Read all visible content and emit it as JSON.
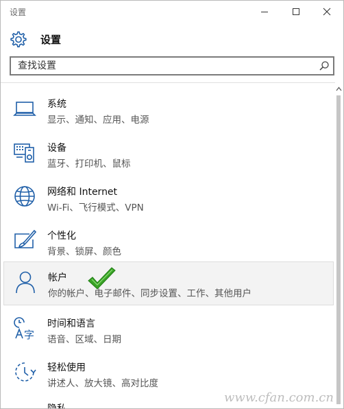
{
  "window": {
    "title": "设置"
  },
  "header": {
    "title": "设置"
  },
  "search": {
    "placeholder": "查找设置"
  },
  "categories": [
    {
      "name": "系统",
      "desc": "显示、通知、应用、电源",
      "icon": "laptop-icon"
    },
    {
      "name": "设备",
      "desc": "蓝牙、打印机、鼠标",
      "icon": "devices-icon"
    },
    {
      "name": "网络和 Internet",
      "desc": "Wi-Fi、飞行模式、VPN",
      "icon": "globe-icon"
    },
    {
      "name": "个性化",
      "desc": "背景、锁屏、颜色",
      "icon": "personalization-icon"
    },
    {
      "name": "帐户",
      "desc": "你的帐户、电子邮件、同步设置、工作、其他用户",
      "icon": "person-icon",
      "selected": true
    },
    {
      "name": "时间和语言",
      "desc": "语音、区域、日期",
      "icon": "time-language-icon"
    },
    {
      "name": "轻松使用",
      "desc": "讲述人、放大镜、高对比度",
      "icon": "ease-of-access-icon"
    },
    {
      "name": "隐私",
      "desc": "",
      "icon": "privacy-icon"
    }
  ],
  "watermark": {
    "text": "www.cfan.com.cn"
  },
  "colors": {
    "icon": "#1f5fa8",
    "check": "#3aa326"
  }
}
